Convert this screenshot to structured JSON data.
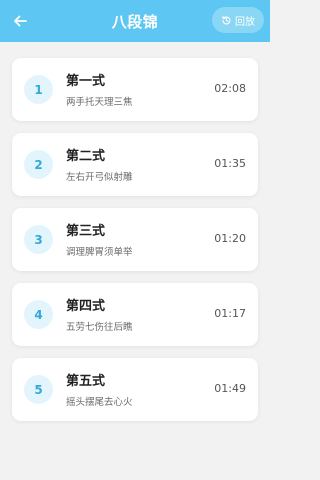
{
  "header": {
    "title": "八段锦",
    "replay_label": "回放",
    "background_color": "#5ec6f2"
  },
  "items": [
    {
      "number": "1",
      "name": "第一式",
      "description": "两手托天理三焦",
      "duration": "02:08"
    },
    {
      "number": "2",
      "name": "第二式",
      "description": "左右开弓似射雕",
      "duration": "01:35"
    },
    {
      "number": "3",
      "name": "第三式",
      "description": "调理脾胃须单举",
      "duration": "01:20"
    },
    {
      "number": "4",
      "name": "第四式",
      "description": "五劳七伤往后瞧",
      "duration": "01:17"
    },
    {
      "number": "5",
      "name": "第五式",
      "description": "摇头摆尾去心火",
      "duration": "01:49"
    }
  ],
  "icons": {
    "back": "arrow-left-icon",
    "replay": "history-icon"
  }
}
